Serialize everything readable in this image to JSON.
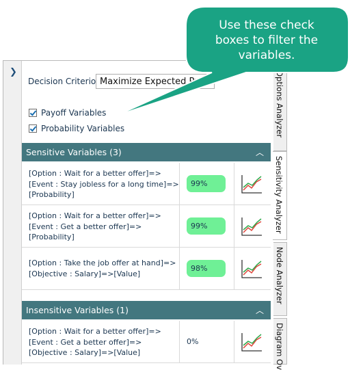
{
  "decision": {
    "label": "Decision Criterion",
    "value": "Maximize Expected Probability"
  },
  "filters": {
    "payoff": "Payoff Variables",
    "probability": "Probability Variables"
  },
  "sensitive": {
    "title": "Sensitive Variables (3)",
    "rows": [
      {
        "lines": [
          "[Option : Wait for a better offer]=>",
          "[Event : Stay jobless for a long time]=>",
          "[Probability]"
        ],
        "value": "99%"
      },
      {
        "lines": [
          "[Option : Wait for a better offer]=>",
          "[Event : Get a better offer]=>",
          "[Probability]"
        ],
        "value": "99%"
      },
      {
        "lines": [
          "[Option : Take the job offer at hand]=>",
          "[Objective : Salary]=>[Value]"
        ],
        "value": "98%"
      }
    ]
  },
  "insensitive": {
    "title": "Insensitive Variables (1)",
    "rows": [
      {
        "lines": [
          "[Option : Wait for a better offer]=>",
          "[Event : Get a better offer]=>",
          "[Objective : Salary]=>[Value]"
        ],
        "value": "0%"
      }
    ]
  },
  "tabs": [
    "Options Analyzer",
    "Sensitivity Analyzer",
    "Node Analyzer",
    "Diagram Ov"
  ],
  "callout": {
    "lines": [
      "Use these check",
      "boxes to filter the",
      "variables."
    ]
  },
  "icons": {
    "collapse": "chevron-right-icon",
    "dropdown": "caret-down-icon",
    "section_toggle": "chevron-up-icon",
    "chart": "line-chart-icon"
  },
  "colors": {
    "section_header": "#43777f",
    "pill": "#6ff096",
    "callout": "#1aa384"
  }
}
